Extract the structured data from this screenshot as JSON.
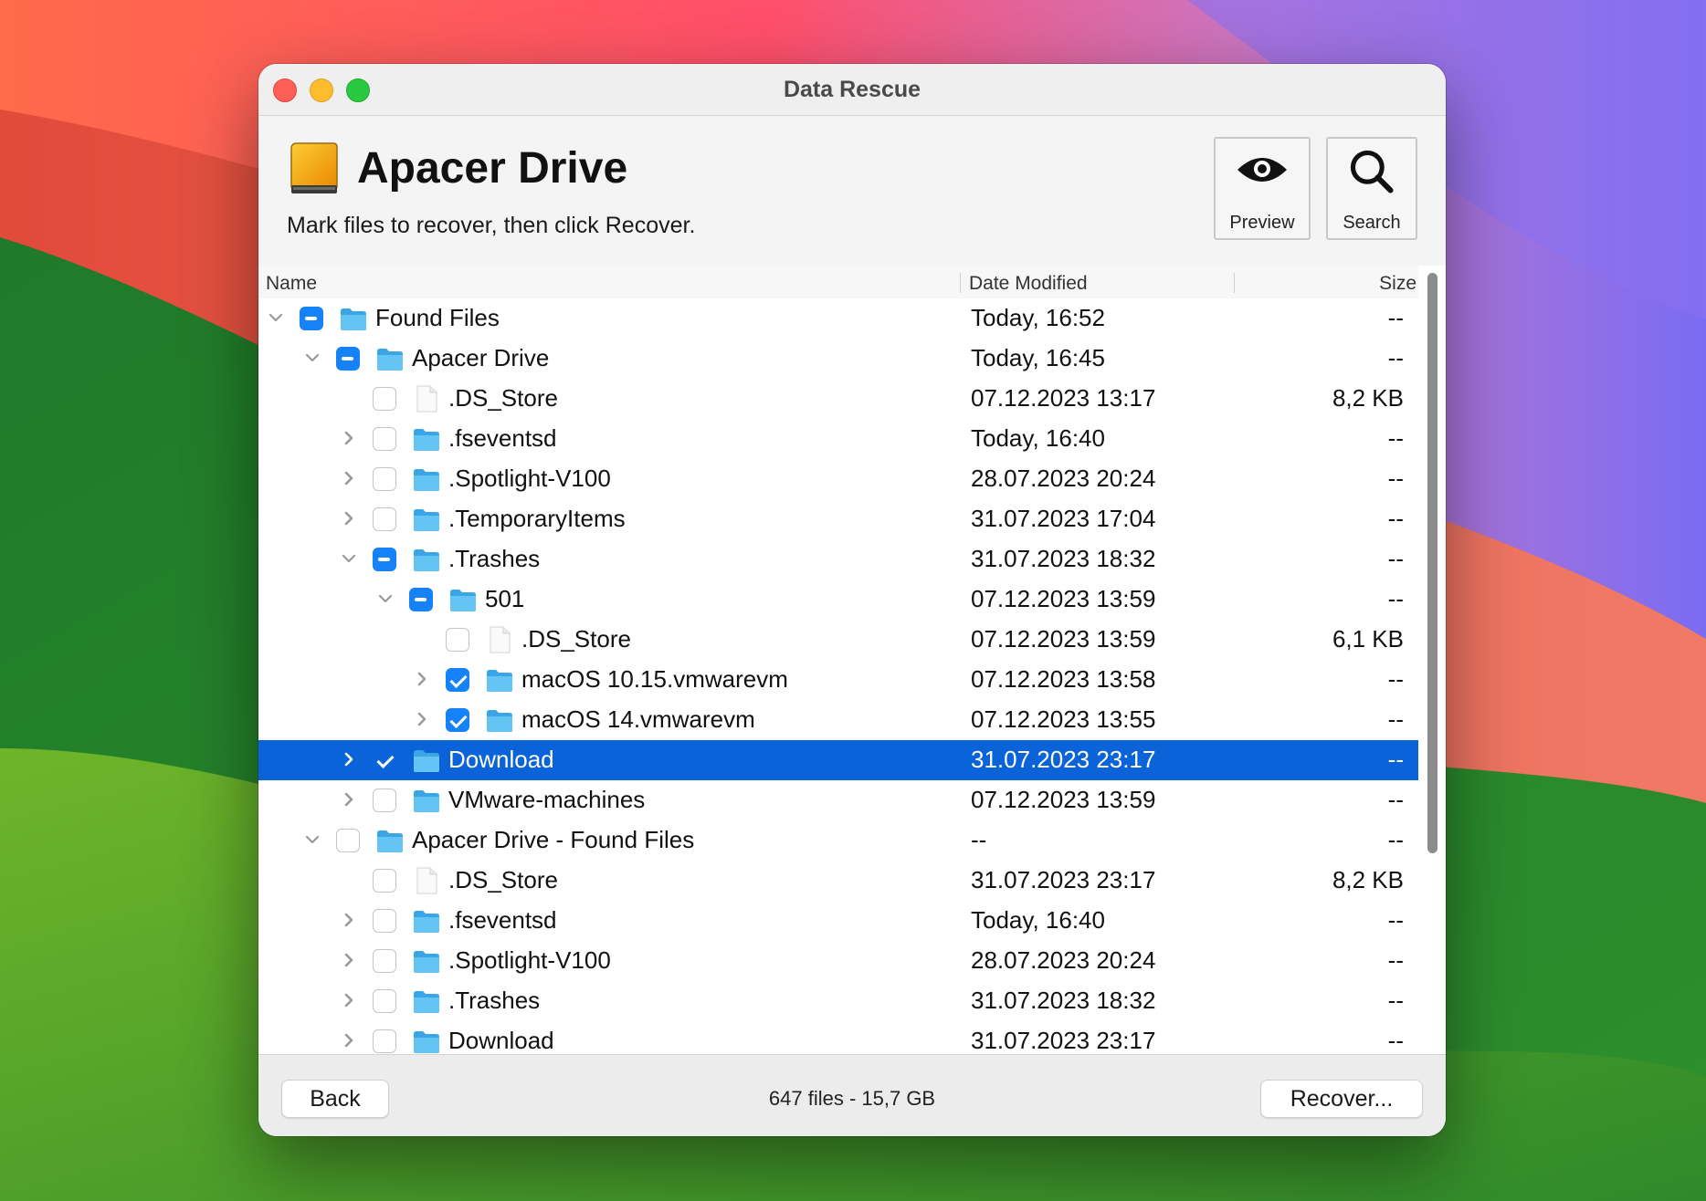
{
  "window": {
    "title": "Data Rescue"
  },
  "header": {
    "drive_name": "Apacer Drive",
    "instruction": "Mark files to recover, then click Recover.",
    "preview_label": "Preview",
    "search_label": "Search"
  },
  "columns": {
    "name": "Name",
    "date": "Date Modified",
    "size": "Size"
  },
  "rows": [
    {
      "level": 0,
      "expand": "expanded",
      "check": "mixed",
      "icon": "folder",
      "name": "Found Files",
      "date": "Today, 16:52",
      "size": "--"
    },
    {
      "level": 1,
      "expand": "expanded",
      "check": "mixed",
      "icon": "folder",
      "name": "Apacer Drive",
      "date": "Today, 16:45",
      "size": "--"
    },
    {
      "level": 2,
      "expand": "none",
      "check": "unchecked",
      "icon": "file",
      "name": ".DS_Store",
      "date": "07.12.2023 13:17",
      "size": "8,2 KB"
    },
    {
      "level": 2,
      "expand": "collapsed",
      "check": "unchecked",
      "icon": "folder",
      "name": ".fseventsd",
      "date": "Today, 16:40",
      "size": "--"
    },
    {
      "level": 2,
      "expand": "collapsed",
      "check": "unchecked",
      "icon": "folder",
      "name": ".Spotlight-V100",
      "date": "28.07.2023 20:24",
      "size": "--"
    },
    {
      "level": 2,
      "expand": "collapsed",
      "check": "unchecked",
      "icon": "folder",
      "name": ".TemporaryItems",
      "date": "31.07.2023 17:04",
      "size": "--"
    },
    {
      "level": 2,
      "expand": "expanded",
      "check": "mixed",
      "icon": "folder",
      "name": ".Trashes",
      "date": "31.07.2023 18:32",
      "size": "--"
    },
    {
      "level": 3,
      "expand": "expanded",
      "check": "mixed",
      "icon": "folder",
      "name": "501",
      "date": "07.12.2023 13:59",
      "size": "--"
    },
    {
      "level": 4,
      "expand": "none",
      "check": "unchecked",
      "icon": "file",
      "name": ".DS_Store",
      "date": "07.12.2023 13:59",
      "size": "6,1 KB"
    },
    {
      "level": 4,
      "expand": "collapsed",
      "check": "checked",
      "icon": "folder",
      "name": "macOS 10.15.vmwarevm",
      "date": "07.12.2023 13:58",
      "size": "--"
    },
    {
      "level": 4,
      "expand": "collapsed",
      "check": "checked",
      "icon": "folder",
      "name": "macOS 14.vmwarevm",
      "date": "07.12.2023 13:55",
      "size": "--"
    },
    {
      "level": 2,
      "expand": "collapsed",
      "check": "checked",
      "icon": "folder",
      "name": "Download",
      "date": "31.07.2023 23:17",
      "size": "--",
      "selected": true
    },
    {
      "level": 2,
      "expand": "collapsed",
      "check": "unchecked",
      "icon": "folder",
      "name": "VMware-machines",
      "date": "07.12.2023 13:59",
      "size": "--"
    },
    {
      "level": 1,
      "expand": "expanded",
      "check": "unchecked",
      "icon": "folder",
      "name": "Apacer Drive - Found Files",
      "date": "--",
      "size": "--"
    },
    {
      "level": 2,
      "expand": "none",
      "check": "unchecked",
      "icon": "file",
      "name": ".DS_Store",
      "date": "31.07.2023 23:17",
      "size": "8,2 KB"
    },
    {
      "level": 2,
      "expand": "collapsed",
      "check": "unchecked",
      "icon": "folder",
      "name": ".fseventsd",
      "date": "Today, 16:40",
      "size": "--"
    },
    {
      "level": 2,
      "expand": "collapsed",
      "check": "unchecked",
      "icon": "folder",
      "name": ".Spotlight-V100",
      "date": "28.07.2023 20:24",
      "size": "--"
    },
    {
      "level": 2,
      "expand": "collapsed",
      "check": "unchecked",
      "icon": "folder",
      "name": ".Trashes",
      "date": "31.07.2023 18:32",
      "size": "--"
    },
    {
      "level": 2,
      "expand": "collapsed",
      "check": "unchecked",
      "icon": "folder",
      "name": "Download",
      "date": "31.07.2023 23:17",
      "size": "--"
    }
  ],
  "footer": {
    "back_label": "Back",
    "status": "647 files - 15,7 GB",
    "recover_label": "Recover..."
  },
  "icons": {
    "preview": "eye-icon",
    "search": "magnifier-icon",
    "drive": "external-drive-icon",
    "folder": "folder-icon",
    "file": "document-icon"
  },
  "colors": {
    "selection": "#0a63d8",
    "checkbox": "#1582f8",
    "folder": "#4fb8f0"
  }
}
